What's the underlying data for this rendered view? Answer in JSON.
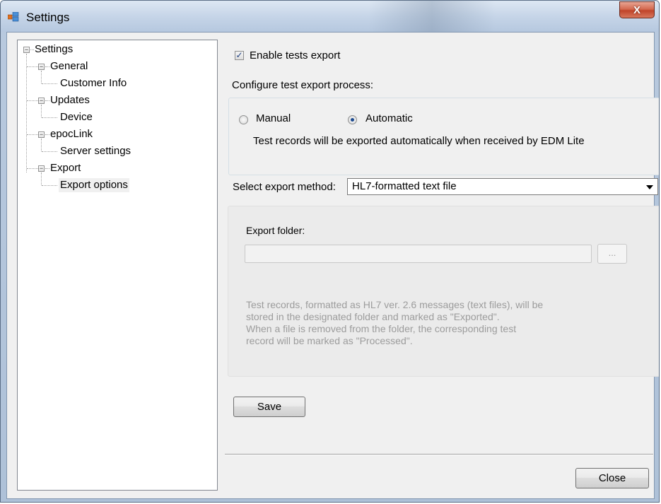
{
  "window": {
    "title": "Settings",
    "close_glyph": "X"
  },
  "tree": {
    "root": "Settings",
    "nodes": [
      {
        "label": "General",
        "children": [
          "Customer Info"
        ]
      },
      {
        "label": "Updates",
        "children": [
          "Device"
        ]
      },
      {
        "label": "epocLink",
        "children": [
          "Server settings"
        ]
      },
      {
        "label": "Export",
        "children": [
          "Export options"
        ]
      }
    ],
    "selected": "Export options"
  },
  "export": {
    "enable_label": "Enable tests export",
    "enable_checked": true,
    "configure_label": "Configure test export process:",
    "mode_manual": "Manual",
    "mode_automatic": "Automatic",
    "selected_mode": "Automatic",
    "auto_description": "Test records will be exported automatically when received by EDM Lite",
    "method_label": "Select export method:",
    "method_value": "HL7-formatted text file",
    "folder_label": "Export folder:",
    "folder_value": "",
    "browse_label": "...",
    "info_text": "Test records, formatted as HL7 ver. 2.6 messages (text files), will be\nstored in the designated folder and marked as \"Exported\".\nWhen a file is removed from the folder, the corresponding test\nrecord will be marked as \"Processed\"."
  },
  "buttons": {
    "save": "Save",
    "close": "Close"
  },
  "icons": {
    "app": "settings-app-icon",
    "collapse": "tree-collapse-icon",
    "dropdown": "chevron-down-icon"
  },
  "colors": {
    "close_button": "#c0442a",
    "checkmark": "#1e3f80",
    "disabled_text": "#9c9c9c"
  }
}
